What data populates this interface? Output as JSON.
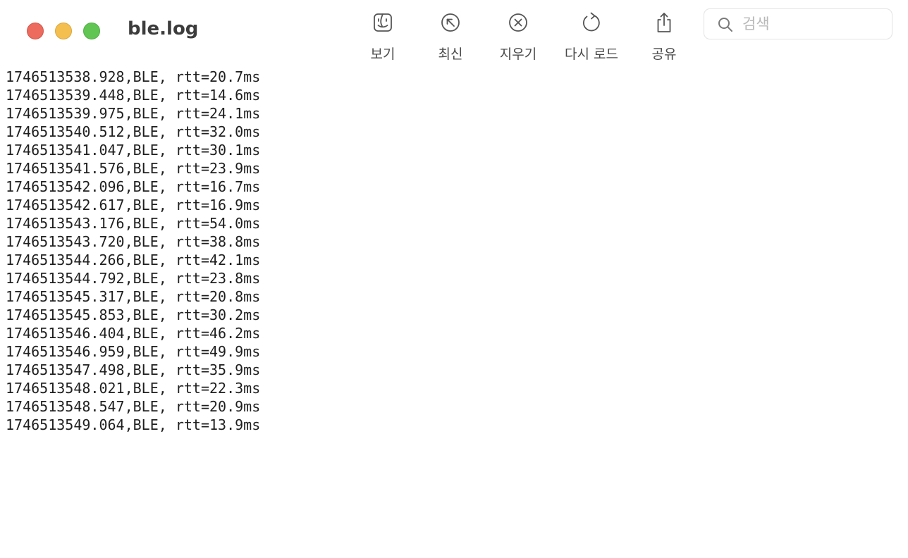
{
  "window": {
    "title": "ble.log"
  },
  "toolbar": {
    "items": [
      {
        "label": "보기",
        "icon": "finder-face-icon"
      },
      {
        "label": "최신",
        "icon": "arrow-up-left-circle-icon"
      },
      {
        "label": "지우기",
        "icon": "x-circle-icon"
      },
      {
        "label": "다시 로드",
        "icon": "reload-icon"
      },
      {
        "label": "공유",
        "icon": "share-icon"
      }
    ]
  },
  "search": {
    "placeholder": "검색",
    "value": ""
  },
  "log_lines": [
    "1746513538.928,BLE, rtt=20.7ms",
    "1746513539.448,BLE, rtt=14.6ms",
    "1746513539.975,BLE, rtt=24.1ms",
    "1746513540.512,BLE, rtt=32.0ms",
    "1746513541.047,BLE, rtt=30.1ms",
    "1746513541.576,BLE, rtt=23.9ms",
    "1746513542.096,BLE, rtt=16.7ms",
    "1746513542.617,BLE, rtt=16.9ms",
    "1746513543.176,BLE, rtt=54.0ms",
    "1746513543.720,BLE, rtt=38.8ms",
    "1746513544.266,BLE, rtt=42.1ms",
    "1746513544.792,BLE, rtt=23.8ms",
    "1746513545.317,BLE, rtt=20.8ms",
    "1746513545.853,BLE, rtt=30.2ms",
    "1746513546.404,BLE, rtt=46.2ms",
    "1746513546.959,BLE, rtt=49.9ms",
    "1746513547.498,BLE, rtt=35.9ms",
    "1746513548.021,BLE, rtt=22.3ms",
    "1746513548.547,BLE, rtt=20.9ms",
    "1746513549.064,BLE, rtt=13.9ms"
  ],
  "colors": {
    "close": "#ec6a5e",
    "minimize": "#f4bf4f",
    "zoom": "#61c554"
  }
}
